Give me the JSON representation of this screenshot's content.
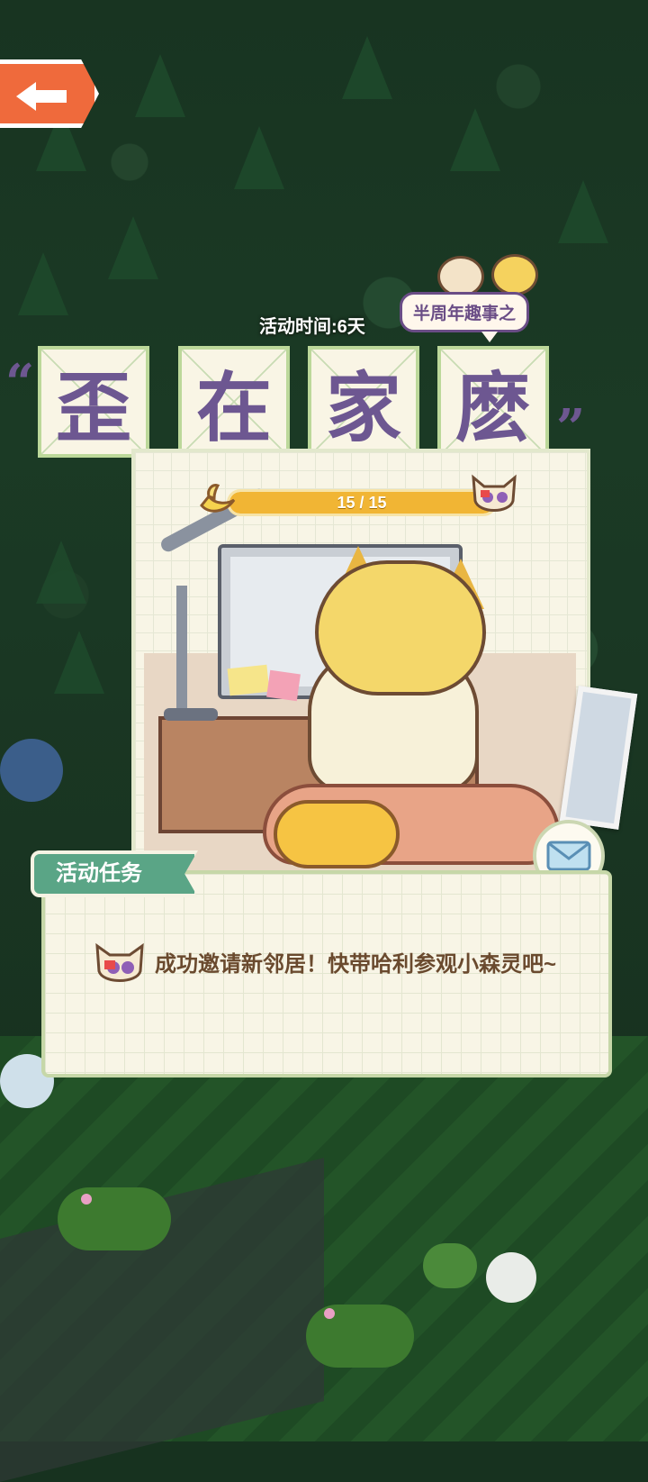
{
  "header": {
    "back_icon": "left-arrow-icon",
    "duration_label": "活动时间:6天",
    "subtitle": "半周年趣事之"
  },
  "title": {
    "chars": [
      "歪",
      "在",
      "家",
      "麽"
    ]
  },
  "progress": {
    "text": "15 / 15",
    "current": 15,
    "total": 15
  },
  "task": {
    "tab_label": "活动任务",
    "description": "成功邀请新邻居！快带哈利参观小森灵吧~"
  },
  "colors": {
    "title_purple": "#6d5791",
    "progress_fill": "#f1b534",
    "task_tab": "#5aa586",
    "back_button": "#ef6a3c"
  }
}
